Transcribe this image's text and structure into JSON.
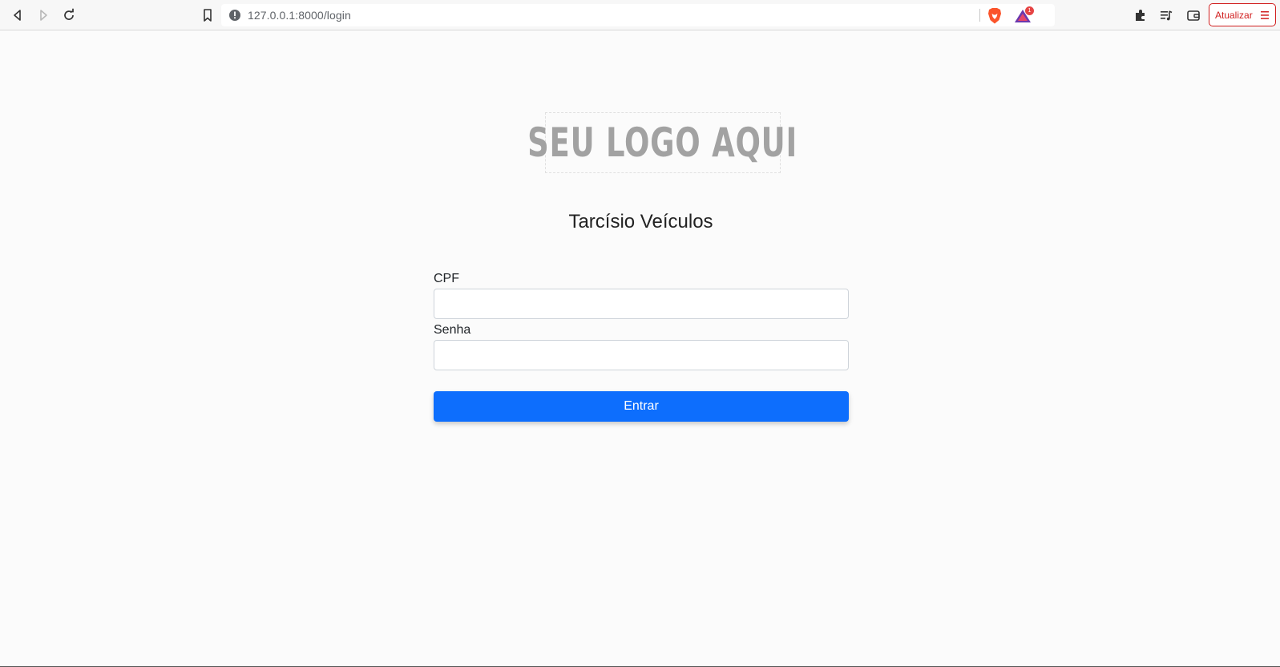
{
  "browser": {
    "url": "127.0.0.1:8000/login",
    "rewards_badge": "1",
    "update_label": "Atualizar",
    "icons": [
      "back-icon",
      "forward-icon",
      "reload-icon",
      "bookmark-icon",
      "info-icon",
      "brave-shields-icon",
      "brave-rewards-icon",
      "extensions-icon",
      "playlist-icon",
      "wallet-icon",
      "menu-icon"
    ]
  },
  "page": {
    "logo_text": "SEU LOGO AQUI",
    "title": "Tarcísio Veículos",
    "form": {
      "cpf_label": "CPF",
      "cpf_value": "",
      "password_label": "Senha",
      "password_value": "",
      "submit_label": "Entrar"
    }
  },
  "colors": {
    "primary": "#0d6efd",
    "update": "#d12020",
    "background": "#fbfbfb"
  }
}
